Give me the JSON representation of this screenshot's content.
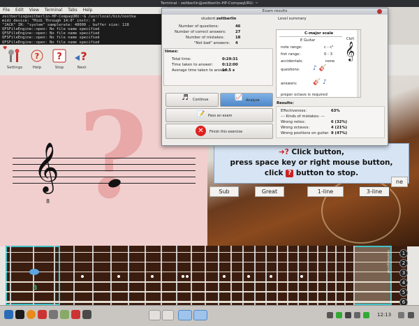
{
  "terminal": {
    "title": "Terminal - zeitberlin@zeitberlin-HP-CompaqURU: ~",
    "menu": [
      "File",
      "Edit",
      "View",
      "Terminal",
      "Tabs",
      "Help"
    ],
    "lines": [
      "zeitberlin@zeitberlin-HP-CompaqURU:~$ /usr/local/bin/nootka",
      "midi device: \"Midi Through 14:0\" instr: 0",
      "\"JACK\" IN: \"system\" samplerate: 48000 , buffer size: 128",
      "QFSFileEngine::open: No file name specified",
      "QFSFileEngine::open: No file name specified",
      "QFSFileEngine::open: No file name specified",
      "QFSFileEngine::open: No file name specified"
    ]
  },
  "toolbar": {
    "settings": "Settings",
    "help": "Help",
    "stop": "Stop",
    "next": "Next"
  },
  "score": {
    "octave_mark": "8"
  },
  "hint": {
    "line1": "Click button,",
    "line2": "press space key or right mouse button,",
    "line3_pre": "click",
    "line3_post": "button to stop."
  },
  "chips": {
    "sub": "Sub",
    "great": "Great",
    "one_line": "1-line",
    "three_line": "3-line",
    "partial": "ne"
  },
  "fretboard": {
    "note_label": "a",
    "string_numbers": [
      "1",
      "2",
      "3",
      "4",
      "5",
      "6"
    ],
    "side_label": "nootka guitar"
  },
  "dialog": {
    "title": "Exam results",
    "student_label": "student:",
    "student_name": "zeitberlin",
    "stats": [
      {
        "label": "Number of questions:",
        "value": "46"
      },
      {
        "label": "Number of correct answers:",
        "value": "27"
      },
      {
        "label": "Number of mistakes:",
        "value": "18"
      },
      {
        "label": "\"Not bad\" answers:",
        "value": "4"
      }
    ],
    "times_header": "times:",
    "times": [
      {
        "label": "Total time:",
        "value": "0:29:31"
      },
      {
        "label": "Time taken to answer:",
        "value": "0:12:00"
      },
      {
        "label": "Average time taken to answer:",
        "value": "14.5 s"
      }
    ],
    "level_summary_label": "Level summary",
    "level_name": "C-major scale",
    "level_rows": [
      {
        "label": "",
        "value": "E Guitar"
      },
      {
        "label": "note range:",
        "value": "c - c³"
      },
      {
        "label": "fret range:",
        "value": "0 - 3"
      },
      {
        "label": "accidentals:",
        "value": "none"
      },
      {
        "label": "questions:",
        "value": ""
      },
      {
        "label": "answers:",
        "value": ""
      },
      {
        "label": "proper octave is required",
        "value": ""
      }
    ],
    "clef_label": "Clef:",
    "buttons": {
      "continue": "Continue",
      "analyze": "Analyze",
      "pass_exam": "Pass an exam",
      "finish": "Finish this exercise"
    },
    "results_header": "Results:",
    "results": [
      {
        "label": "Effectiveness:",
        "value": "63%"
      },
      {
        "label": "--- Kinds of mistakes: ---",
        "value": ""
      },
      {
        "label": "Wrong notes:",
        "value": "6 (32%)"
      },
      {
        "label": "Wrong octaves:",
        "value": "4 (21%)"
      },
      {
        "label": "Wrong positions on guitar:",
        "value": "9 (47%)"
      }
    ]
  },
  "taskbar": {
    "clock": "12:13"
  }
}
